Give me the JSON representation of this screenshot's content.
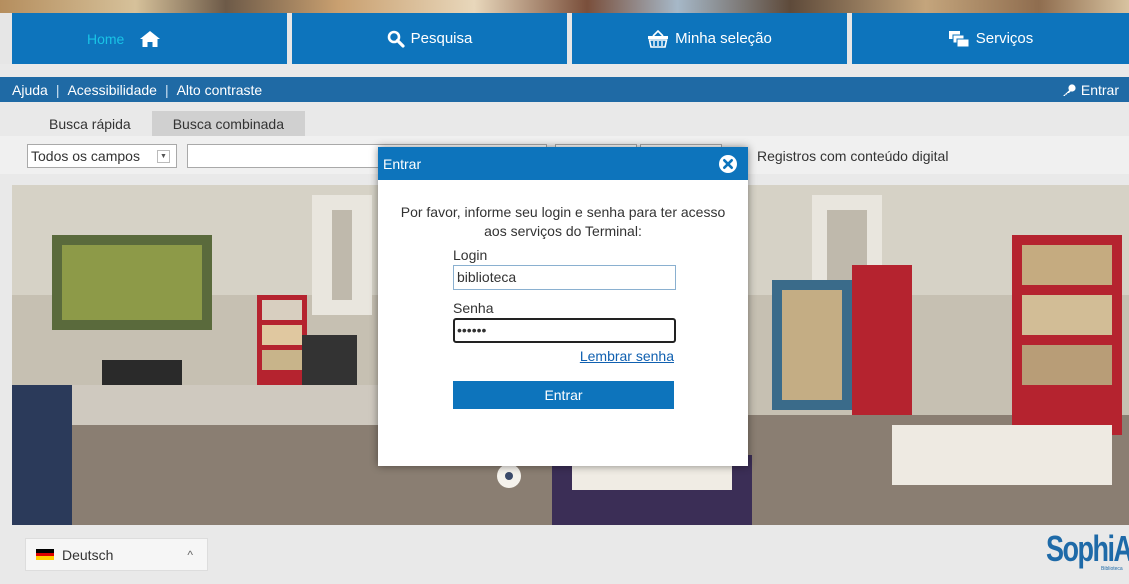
{
  "nav": {
    "items": [
      {
        "label": "Home",
        "icon": "home-icon",
        "active": true
      },
      {
        "label": "Pesquisa",
        "icon": "search-icon",
        "active": false
      },
      {
        "label": "Minha seleção",
        "icon": "basket-icon",
        "active": false
      },
      {
        "label": "Serviços",
        "icon": "services-icon",
        "active": false
      }
    ]
  },
  "subbar": {
    "links": [
      "Ajuda",
      "Acessibilidade",
      "Alto contraste"
    ],
    "separator": "|",
    "login_label": "Entrar",
    "login_icon": "key-icon"
  },
  "search": {
    "tabs": [
      "Busca rápida",
      "Busca combinada"
    ],
    "field_select": "Todos os campos",
    "query_value": "",
    "digital_only_label": "Registros com conteúdo digital"
  },
  "modal": {
    "title": "Entrar",
    "message": "Por favor, informe seu login e senha para ter acesso aos serviços do Terminal:",
    "login_label": "Login",
    "login_value": "biblioteca",
    "password_label": "Senha",
    "password_value": "••••••",
    "remember_link": "Lembrar senha",
    "submit_label": "Entrar"
  },
  "footer": {
    "language": "Deutsch",
    "logo_text": "SophiA",
    "logo_sub": "Biblioteca"
  },
  "colors": {
    "primary": "#0d74bc",
    "subbar": "#1f6aa5",
    "active_nav_text": "#19c3e6",
    "link": "#1060b0"
  }
}
